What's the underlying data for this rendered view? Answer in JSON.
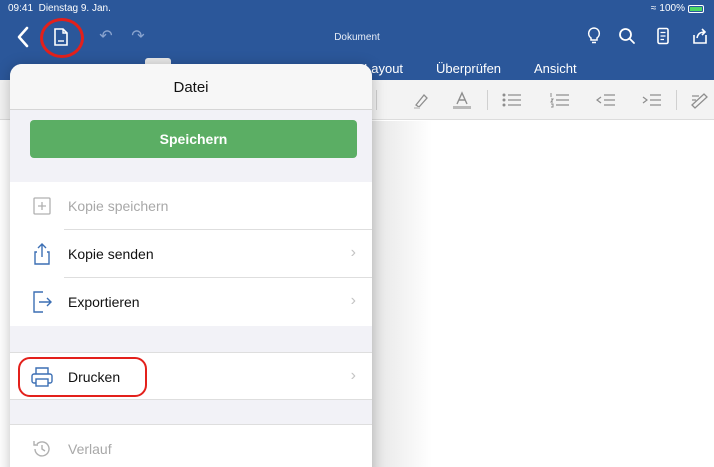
{
  "status": {
    "time": "09:41",
    "date": "Dienstag 9. Jan.",
    "battery": "100%"
  },
  "document": {
    "title": "Dokument"
  },
  "tabs": [
    {
      "label": "Layout"
    },
    {
      "label": "Überprüfen"
    },
    {
      "label": "Ansicht"
    }
  ],
  "menu": {
    "title": "Datei",
    "save_label": "Speichern",
    "items": [
      {
        "label": "Kopie speichern",
        "icon": "add-copy-icon",
        "enabled": false
      },
      {
        "label": "Kopie senden",
        "icon": "share-icon",
        "enabled": true
      },
      {
        "label": "Exportieren",
        "icon": "export-icon",
        "enabled": true
      },
      {
        "label": "Drucken",
        "icon": "printer-icon",
        "enabled": true
      },
      {
        "label": "Verlauf",
        "icon": "history-icon",
        "enabled": false
      }
    ]
  },
  "colors": {
    "header_blue": "#2b579a",
    "save_green": "#5bae64",
    "highlight_red": "#e3201b"
  }
}
